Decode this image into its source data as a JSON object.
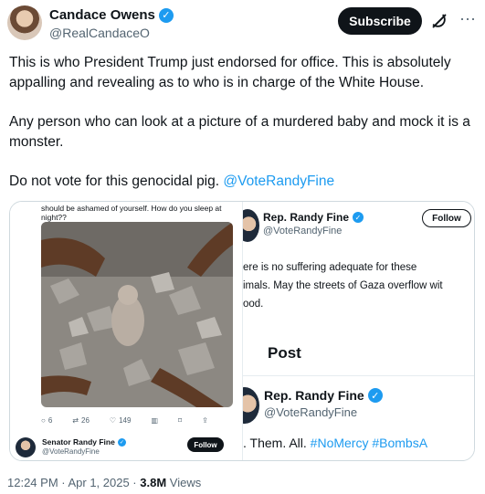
{
  "author": {
    "name": "Candace Owens",
    "handle": "@RealCandaceO"
  },
  "header": {
    "subscribe_label": "Subscribe"
  },
  "tweet": {
    "paragraphs": [
      "This is who President Trump just endorsed for office. This is absolutely appalling and revealing as to who is in charge of the White House.",
      "Any person who can look at a picture of a murdered baby and mock it is a monster."
    ],
    "last_line_text": "Do not vote for this genocidal pig. ",
    "mention": "@VoteRandyFine"
  },
  "media": {
    "left": {
      "quote_text": "should be ashamed of yourself. How do you sleep at night??",
      "actions": {
        "replies": "6",
        "reposts": "26",
        "likes": "149"
      },
      "senator_name": "Senator Randy Fine",
      "senator_handle": "@VoteRandyFine",
      "follow_label": "Follow"
    },
    "right": {
      "name": "Rep. Randy Fine",
      "handle": "@VoteRandyFine",
      "follow_label": "Follow",
      "body_lines": [
        "ere is no suffering adequate for these",
        "imals. May the streets of Gaza overflow wit",
        "ood."
      ],
      "post_label": "Post",
      "name2": "Rep. Randy Fine",
      "handle2": "@VoteRandyFine",
      "tags_prefix": ". Them. All. ",
      "tags": "#NoMercy #BombsA"
    }
  },
  "footer": {
    "time": "12:24 PM · Apr 1, 2025 · ",
    "views_count": "3.8M",
    "views_label": " Views"
  },
  "colors": {
    "accent": "#1d9bf0",
    "text": "#0f1419",
    "muted": "#536471"
  }
}
